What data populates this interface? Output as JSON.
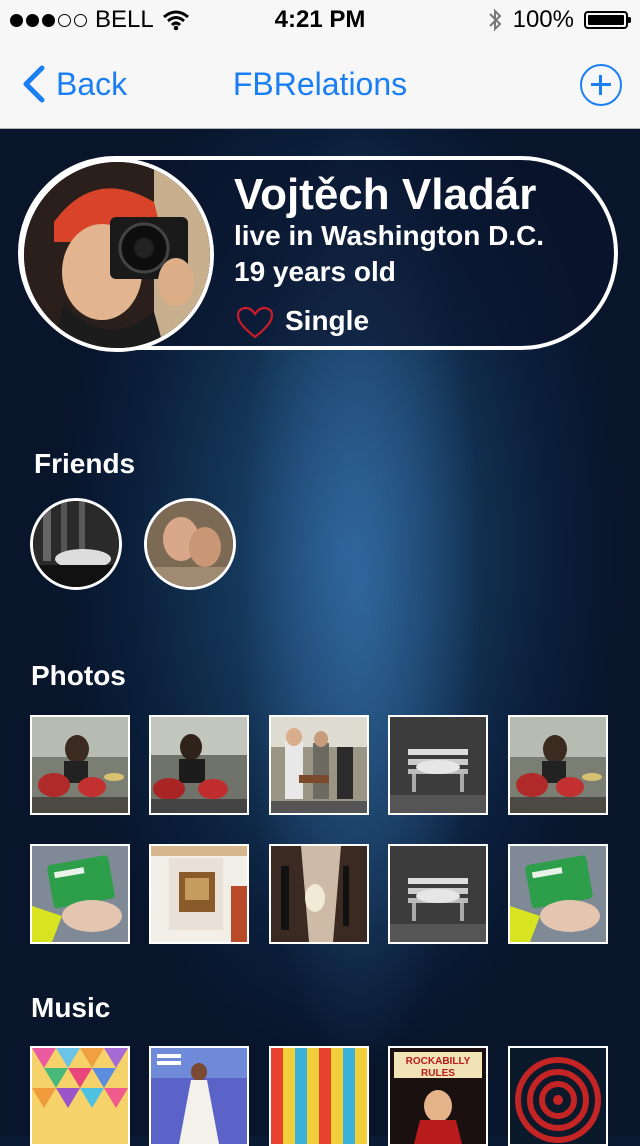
{
  "status_bar": {
    "carrier": "BELL",
    "time": "4:21 PM",
    "battery": "100%",
    "signal_bars_filled": 3,
    "signal_bars_total": 5
  },
  "nav": {
    "back_label": "Back",
    "title": "FBRelations",
    "accent_color": "#1a7ff4"
  },
  "profile": {
    "name": "Vojtěch Vladár",
    "location": "live in Washington D.C.",
    "age": "19 years old",
    "relationship": "Single"
  },
  "friends": {
    "title": "Friends",
    "items": [
      {
        "icon": "friend-avatar-bw"
      },
      {
        "icon": "friend-avatar-couple"
      }
    ]
  },
  "photos": {
    "title": "Photos",
    "items": [
      {
        "icon": "drummer-photo"
      },
      {
        "icon": "drummer-photo"
      },
      {
        "icon": "guitarists-photo"
      },
      {
        "icon": "bench-bw-photo"
      },
      {
        "icon": "drummer-photo"
      },
      {
        "icon": "card-hand-photo"
      },
      {
        "icon": "frame-wall-photo"
      },
      {
        "icon": "studio-room-photo"
      },
      {
        "icon": "bench-bw-photo"
      },
      {
        "icon": "card-hand-photo"
      }
    ]
  },
  "music": {
    "title": "Music",
    "items": [
      {
        "icon": "geometric-album"
      },
      {
        "icon": "girl-dress-album"
      },
      {
        "icon": "bell-poster-album"
      },
      {
        "icon": "rockabilly-album",
        "text": "ROCKABILLY RULES"
      },
      {
        "icon": "red-circles-album"
      }
    ]
  }
}
